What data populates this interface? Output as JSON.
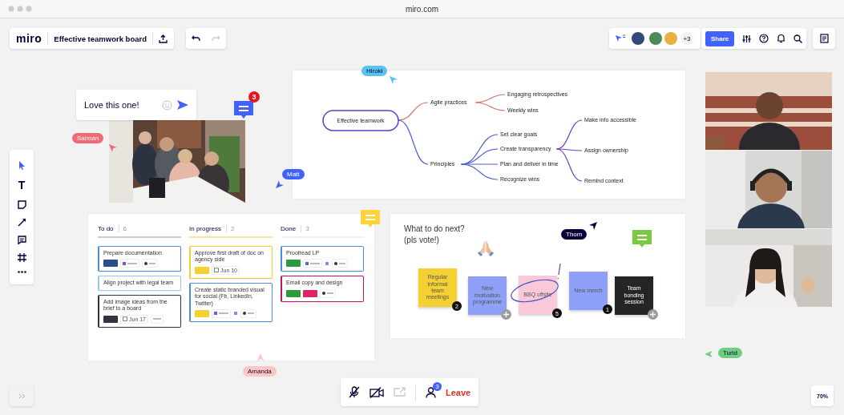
{
  "browser": {
    "url": "miro.com"
  },
  "board": {
    "logo": "miro",
    "title": "Effective teamwork board",
    "redo_disabled": true
  },
  "collaborators": {
    "extra": "+3"
  },
  "share_button": "Share",
  "zoom_level": "70%",
  "tools": [
    {
      "kind": "select",
      "selected": true
    },
    {
      "kind": "text",
      "glyph": "T",
      "selected": false
    },
    {
      "kind": "sticky",
      "selected": false
    },
    {
      "kind": "line",
      "selected": false
    },
    {
      "kind": "comment",
      "selected": false
    },
    {
      "kind": "frame",
      "selected": false
    },
    {
      "kind": "more",
      "selected": false
    }
  ],
  "comment": {
    "text": "Love this one!"
  },
  "comment_markers": [
    {
      "color": "#4262ff",
      "count": "3"
    },
    {
      "color": "#fcd33b"
    },
    {
      "color": "#7ac943"
    }
  ],
  "cursors": [
    {
      "name": "Hiroki",
      "color": "#5bc3f0"
    },
    {
      "name": "Salman",
      "color": "#f06a75"
    },
    {
      "name": "Matt",
      "color": "#4262ff"
    },
    {
      "name": "Thom",
      "color": "#050038"
    },
    {
      "name": "Amanda",
      "color": "#ffc6c6"
    },
    {
      "name": "Turid",
      "color": "#6fcf7f"
    }
  ],
  "mindmap": {
    "label": "Effective teamwork",
    "color": "#5b3fc4",
    "children": [
      {
        "label": "Agile practices",
        "color": "#e0706b",
        "children": [
          {
            "label": "Engaging retrospectives"
          },
          {
            "label": "Weekly wins"
          }
        ]
      },
      {
        "label": "Principles",
        "color": "#4a5fd0",
        "children": [
          {
            "label": "Set clear goals"
          },
          {
            "label": "Create transparency",
            "children": [
              {
                "label": "Make info accessible",
                "color": "#6b3fc0"
              },
              {
                "label": "Assign ownership",
                "color": "#6b3fc0"
              },
              {
                "label": "Remind context",
                "color": "#6b3fc0"
              }
            ]
          },
          {
            "label": "Plan and deliver in time"
          },
          {
            "label": "Recognize wins"
          }
        ]
      }
    ]
  },
  "kanban": {
    "columns": [
      {
        "title": "To do",
        "count": "6",
        "cards": [
          {
            "title": "Prepare documentation",
            "color": "#4a90e2",
            "chips": [
              {
                "kind": "tag",
                "color": "#2d4f8a"
              },
              {
                "kind": "ticket"
              },
              {
                "kind": "person"
              }
            ]
          },
          {
            "title": "Align project with legal team",
            "color": "#8ecbf0"
          },
          {
            "title": "Add image ideas from the brief to a board",
            "color": "#333340",
            "chips": [
              {
                "kind": "tag",
                "color": "#333340"
              },
              {
                "kind": "date",
                "text": "Jun 17"
              },
              {
                "kind": "label"
              }
            ]
          }
        ]
      },
      {
        "title": "In progress",
        "count": "2",
        "cards": [
          {
            "title": "Approve first draft of doc on agency side",
            "color": "#f5d033",
            "chips": [
              {
                "kind": "tag",
                "color": "#f5d033"
              },
              {
                "kind": "date",
                "text": "Jun 10"
              }
            ]
          },
          {
            "title": "Create static branded visual for social (Fb, LinkedIn, Twitter)",
            "color": "#4a90e2",
            "chips": [
              {
                "kind": "tag",
                "color": "#f5d033"
              },
              {
                "kind": "ticket"
              },
              {
                "kind": "link"
              },
              {
                "kind": "person"
              }
            ]
          }
        ]
      },
      {
        "title": "Done",
        "count": "3",
        "cards": [
          {
            "title": "Proofread LP",
            "color": "#4a90e2",
            "chips": [
              {
                "kind": "tag",
                "color": "#2e9a3e"
              },
              {
                "kind": "ticket"
              },
              {
                "kind": "link"
              },
              {
                "kind": "person"
              }
            ]
          },
          {
            "title": "Email copy and design",
            "color": "#c2185b",
            "chips": [
              {
                "kind": "tag",
                "color": "#2e9a3e"
              },
              {
                "kind": "tag",
                "color": "#e0245e"
              },
              {
                "kind": "person"
              }
            ]
          }
        ]
      }
    ]
  },
  "vote": {
    "title_lines": [
      "What to do next?",
      "(pls vote!)"
    ],
    "stickies": [
      {
        "text": "Regular informal team meetings",
        "color": "#f5d033",
        "badge": {
          "kind": "votes",
          "text": "2"
        }
      },
      {
        "text": "New motivation programme",
        "color": "#8fa0f8",
        "badge": {
          "kind": "add"
        }
      },
      {
        "text": "BBQ offsite",
        "color": "#f9c9d9",
        "circled": true,
        "badge": {
          "kind": "votes",
          "text": "5"
        }
      },
      {
        "text": "New merch",
        "color": "#8fa0f8",
        "badge": {
          "kind": "votes",
          "text": "1"
        }
      },
      {
        "text": "Team bonding session",
        "color": "#252525",
        "badge": {
          "kind": "add"
        }
      }
    ]
  },
  "call_bar": {
    "mic_muted": true,
    "camera_off": true,
    "screen_share_disabled": true,
    "participants_count": "3",
    "leave_label": "Leave"
  }
}
